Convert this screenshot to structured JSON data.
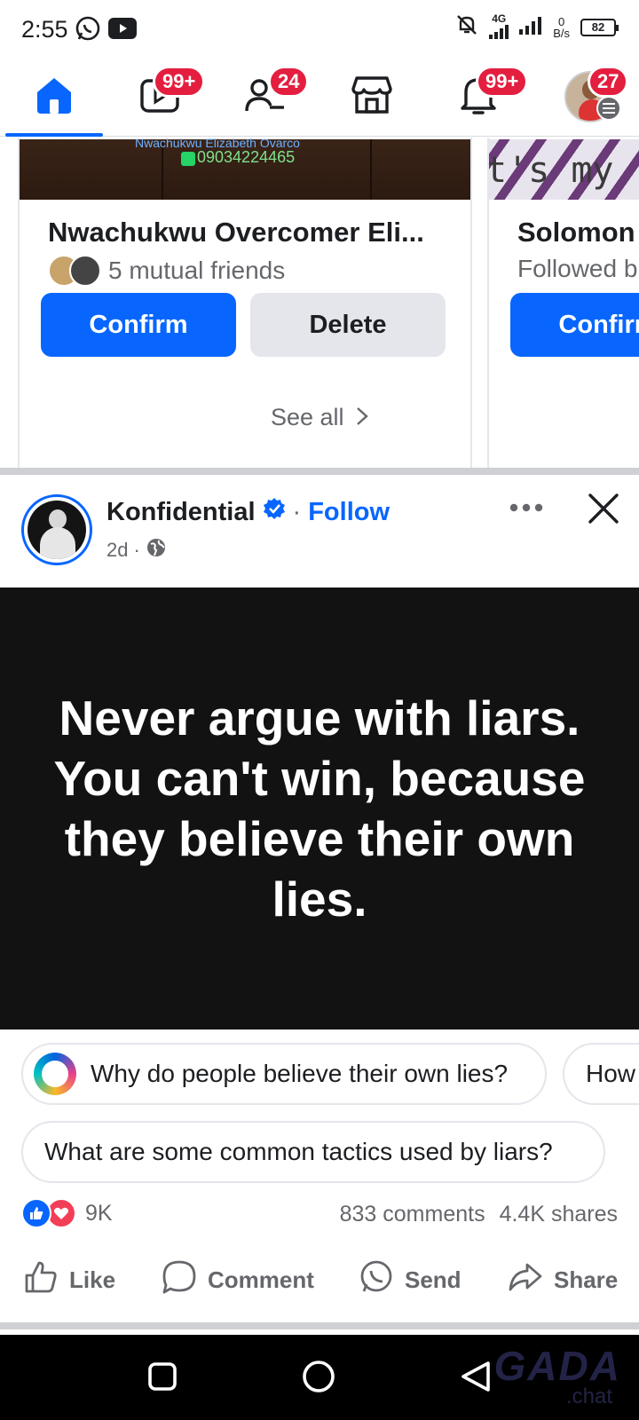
{
  "status_bar": {
    "time": "2:55",
    "network": "4G",
    "speed_value": "0",
    "speed_unit": "B/s",
    "battery": "82"
  },
  "top_nav": {
    "items": [
      {
        "name": "home",
        "badge": ""
      },
      {
        "name": "video",
        "badge": "99+"
      },
      {
        "name": "friends",
        "badge": "24"
      },
      {
        "name": "marketplace",
        "badge": ""
      },
      {
        "name": "notifications",
        "badge": "99+"
      },
      {
        "name": "menu",
        "badge": "27"
      }
    ]
  },
  "friend_suggestions": {
    "cards": [
      {
        "image_text_1": "Nwachukwu Elizabeth Ovarco",
        "image_text_2": "09034224465",
        "name": "Nwachukwu Overcomer Eli...",
        "subtitle": "5 mutual friends",
        "confirm_label": "Confirm",
        "delete_label": "Delete"
      },
      {
        "image_text": "t's my",
        "name": "Solomon",
        "subtitle": "Followed b",
        "confirm_label": "Confirm"
      }
    ],
    "see_all_label": "See all"
  },
  "post": {
    "page_name": "Konfidential",
    "separator": "·",
    "follow_label": "Follow",
    "time": "2d",
    "meta_separator": "·",
    "quote": "Never argue with liars. You can't win, because they believe their own lies.",
    "suggested_questions": [
      "Why do people believe their own lies?",
      "How",
      "What are some common tactics used by liars?"
    ],
    "reaction_count": "9K",
    "comments": "833 comments",
    "shares": "4.4K shares",
    "actions": {
      "like": "Like",
      "comment": "Comment",
      "send": "Send",
      "share": "Share"
    }
  },
  "watermark": {
    "main": "GADA",
    "sub": ".chat"
  },
  "colors": {
    "brand_blue": "#0866ff",
    "badge_red": "#e41e3f",
    "quote_background": "#121212",
    "secondary_text": "#65676b"
  }
}
